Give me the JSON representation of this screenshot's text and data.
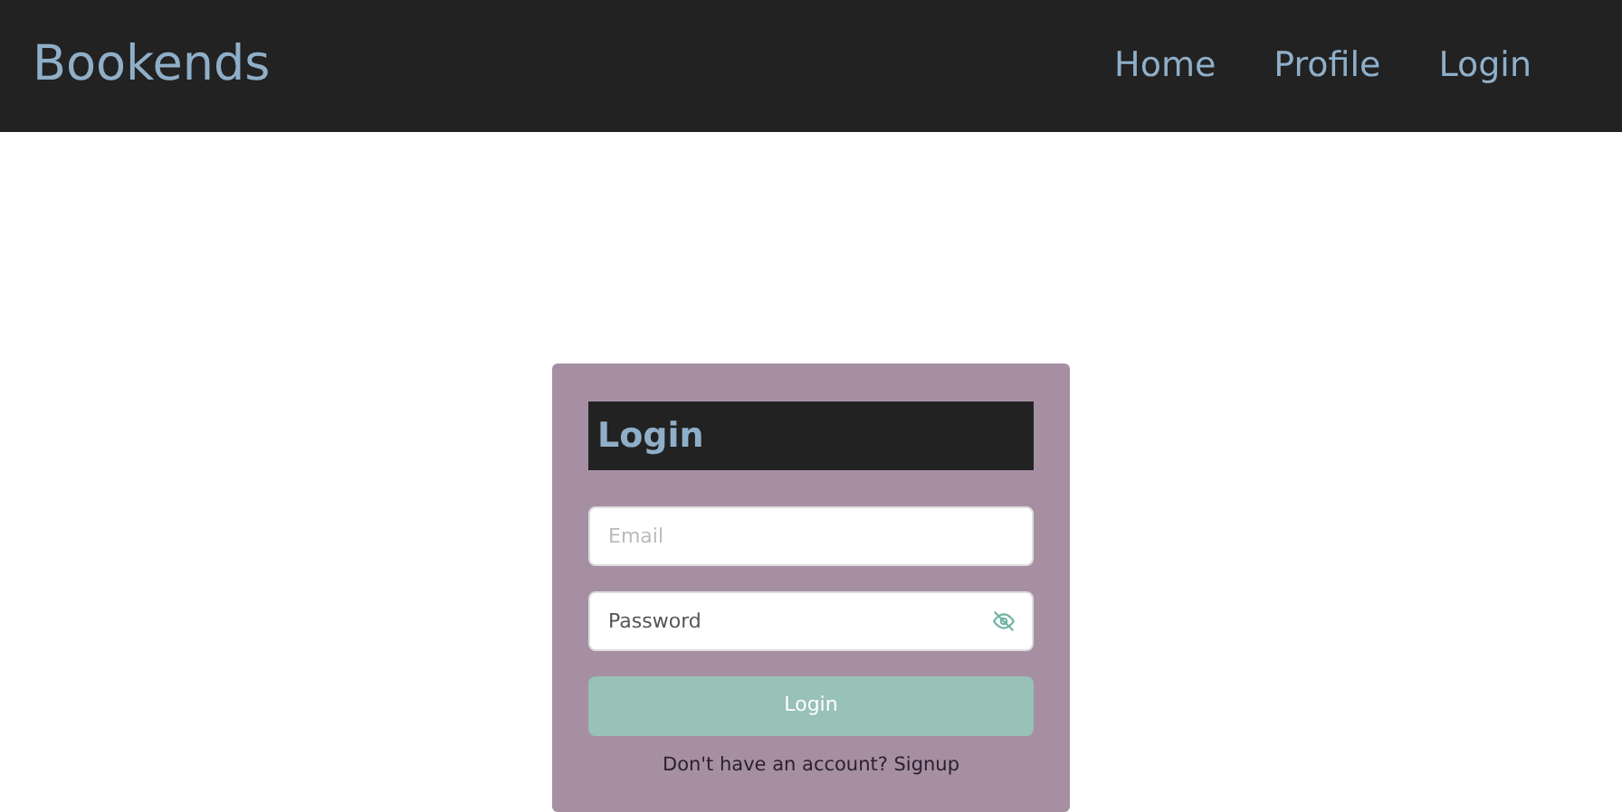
{
  "navbar": {
    "brand": "Bookends",
    "links": [
      {
        "label": "Home"
      },
      {
        "label": "Profile"
      },
      {
        "label": "Login"
      }
    ]
  },
  "login_card": {
    "title": "Login",
    "fields": [
      {
        "kind": "email",
        "placeholder": "Email"
      },
      {
        "kind": "password",
        "placeholder": "Password"
      }
    ],
    "button": "Login",
    "footer": {
      "text": "Don't have an account?",
      "link": "Signup"
    }
  }
}
